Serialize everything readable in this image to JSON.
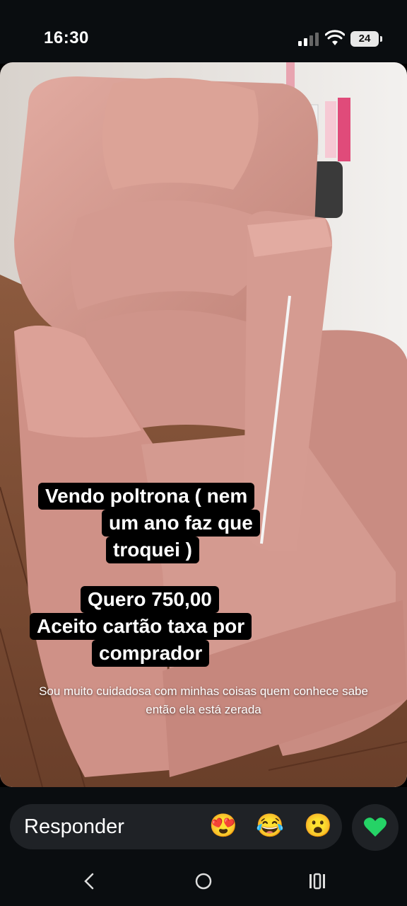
{
  "status_bar": {
    "time": "16:30",
    "battery_level": "24",
    "icons": [
      "signal-icon",
      "wifi-icon",
      "battery-icon"
    ]
  },
  "story": {
    "caption_lines_1": [
      "Vendo poltrona ( nem",
      "um ano faz que",
      "troquei )"
    ],
    "caption_lines_2": [
      "Quero 750,00",
      "Aceito cartão taxa por",
      "comprador"
    ],
    "small_caption": "Sou muito cuidadosa com minhas coisas quem conhece sabe então ela está zerada",
    "colors": {
      "armchair": "#d49a90",
      "floor": "#7a4a32",
      "wall": "#ece8e6"
    }
  },
  "reply": {
    "placeholder": "Responder",
    "reactions": [
      "😍",
      "😂",
      "😮"
    ],
    "icons": [
      "heart-eyes-emoji-icon",
      "tears-of-joy-emoji-icon",
      "surprised-emoji-icon",
      "green-heart-icon"
    ],
    "heart_color": "#25d366"
  },
  "nav": {
    "icons": [
      "back-icon",
      "home-icon",
      "recents-icon"
    ]
  }
}
